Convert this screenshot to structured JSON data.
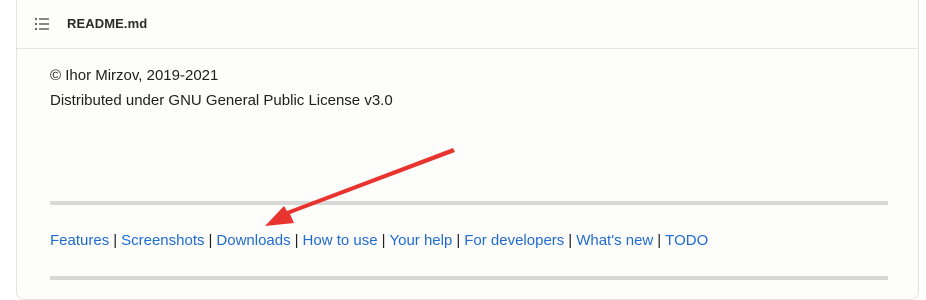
{
  "readme": {
    "title": "README.md",
    "toc_icon": "list-icon"
  },
  "content": {
    "copyright": "© Ihor Mirzov, 2019-2021",
    "license": "Distributed under GNU General Public License v3.0"
  },
  "nav": {
    "links": [
      "Features",
      "Screenshots",
      "Downloads",
      "How to use",
      "Your help",
      "For developers",
      "What's new",
      "TODO"
    ],
    "separator": "|"
  },
  "annotation": {
    "arrow_color": "#e8332f",
    "points_to": "Downloads"
  },
  "colors": {
    "link": "#1f6bd0",
    "text": "#202020",
    "rule": "#d8d8d5"
  }
}
